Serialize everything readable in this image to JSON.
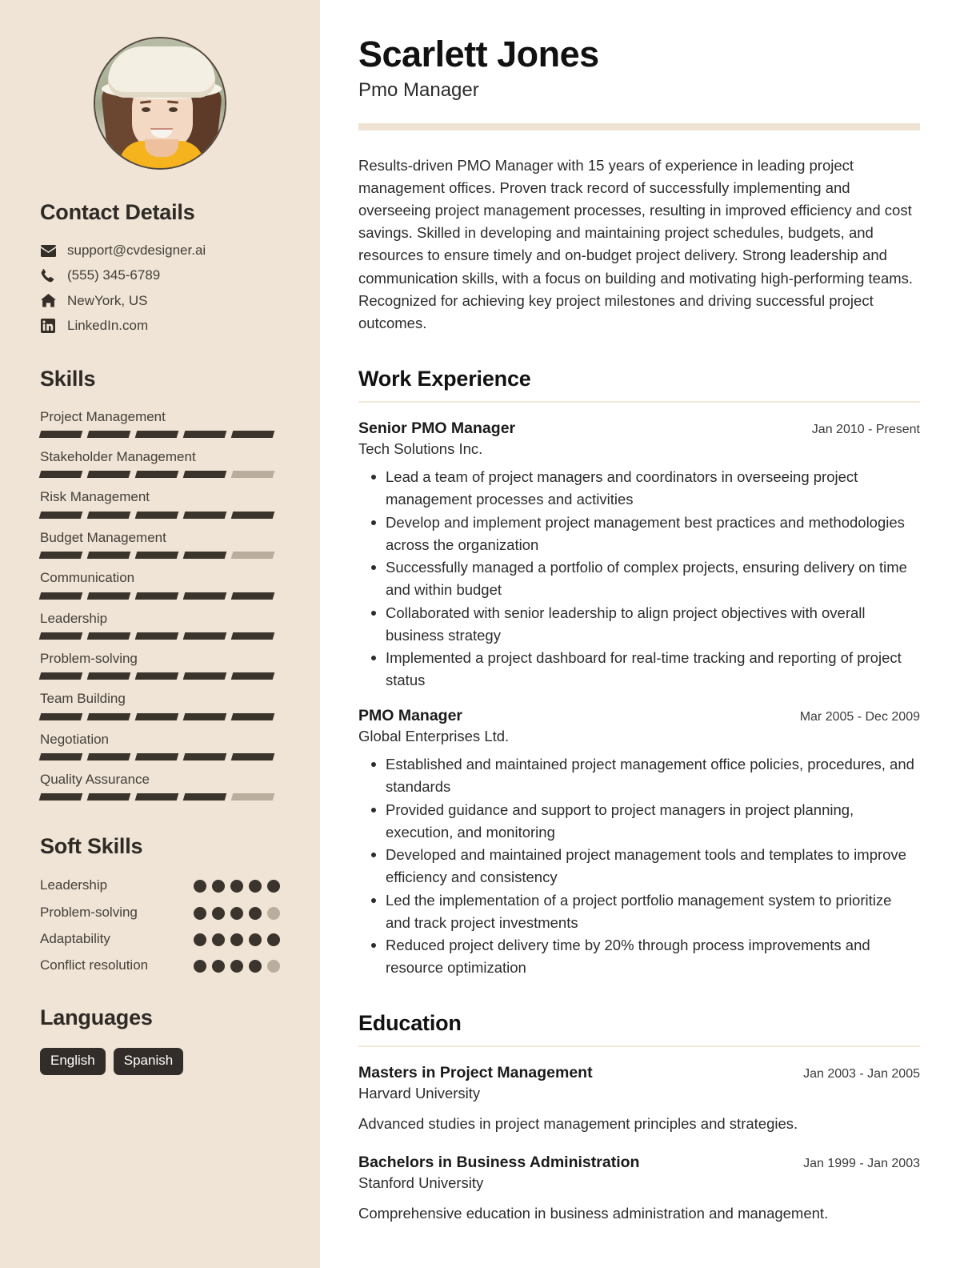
{
  "theme": {
    "sidebar_bg": "#efe4d5",
    "page_bg": "#ffffff",
    "ink": "#2c2c2c",
    "accent_bar": "#eee3d3",
    "bar_on": "#3a342d",
    "bar_off": "#b9ae9d",
    "chip_bg": "#322d28"
  },
  "header": {
    "name": "Scarlett Jones",
    "title": "Pmo Manager"
  },
  "summary": "Results-driven PMO Manager with 15 years of experience in leading project management offices. Proven track record of successfully implementing and overseeing project management processes, resulting in improved efficiency and cost savings. Skilled in developing and maintaining project schedules, budgets, and resources to ensure timely and on-budget project delivery. Strong leadership and communication skills, with a focus on building and motivating high-performing teams. Recognized for achieving key project milestones and driving successful project outcomes.",
  "sidebar": {
    "avatar_alt": "profile-photo",
    "contact": {
      "heading": "Contact Details",
      "items": [
        {
          "icon": "envelope-icon",
          "value": "support@cvdesigner.ai"
        },
        {
          "icon": "phone-icon",
          "value": "(555) 345-6789"
        },
        {
          "icon": "home-icon",
          "value": "NewYork, US"
        },
        {
          "icon": "linkedin-icon",
          "value": "LinkedIn.com"
        }
      ]
    },
    "skills": {
      "heading": "Skills",
      "max": 5,
      "items": [
        {
          "name": "Project Management",
          "level": 5
        },
        {
          "name": "Stakeholder Management",
          "level": 4
        },
        {
          "name": "Risk Management",
          "level": 5
        },
        {
          "name": "Budget Management",
          "level": 4
        },
        {
          "name": "Communication",
          "level": 5
        },
        {
          "name": "Leadership",
          "level": 5
        },
        {
          "name": "Problem-solving",
          "level": 5
        },
        {
          "name": "Team Building",
          "level": 5
        },
        {
          "name": "Negotiation",
          "level": 5
        },
        {
          "name": "Quality Assurance",
          "level": 4
        }
      ]
    },
    "soft_skills": {
      "heading": "Soft Skills",
      "max": 5,
      "items": [
        {
          "name": "Leadership",
          "level": 5
        },
        {
          "name": "Problem-solving",
          "level": 4
        },
        {
          "name": "Adaptability",
          "level": 5
        },
        {
          "name": "Conflict resolution",
          "level": 4
        }
      ]
    },
    "languages": {
      "heading": "Languages",
      "items": [
        "English",
        "Spanish"
      ]
    }
  },
  "work": {
    "heading": "Work Experience",
    "entries": [
      {
        "role": "Senior PMO Manager",
        "org": "Tech Solutions Inc.",
        "date": "Jan 2010 - Present",
        "bullets": [
          "Lead a team of project managers and coordinators in overseeing project management processes and activities",
          "Develop and implement project management best practices and methodologies across the organization",
          "Successfully managed a portfolio of complex projects, ensuring delivery on time and within budget",
          "Collaborated with senior leadership to align project objectives with overall business strategy",
          "Implemented a project dashboard for real-time tracking and reporting of project status"
        ]
      },
      {
        "role": "PMO Manager",
        "org": "Global Enterprises Ltd.",
        "date": "Mar 2005 - Dec 2009",
        "bullets": [
          "Established and maintained project management office policies, procedures, and standards",
          "Provided guidance and support to project managers in project planning, execution, and monitoring",
          "Developed and maintained project management tools and templates to improve efficiency and consistency",
          "Led the implementation of a project portfolio management system to prioritize and track project investments",
          "Reduced project delivery time by 20% through process improvements and resource optimization"
        ]
      }
    ]
  },
  "education": {
    "heading": "Education",
    "entries": [
      {
        "degree": "Masters in Project Management",
        "school": "Harvard University",
        "date": "Jan 2003 - Jan 2005",
        "description": "Advanced studies in project management principles and strategies."
      },
      {
        "degree": "Bachelors in Business Administration",
        "school": "Stanford University",
        "date": "Jan 1999 - Jan 2003",
        "description": "Comprehensive education in business administration and management."
      }
    ]
  }
}
